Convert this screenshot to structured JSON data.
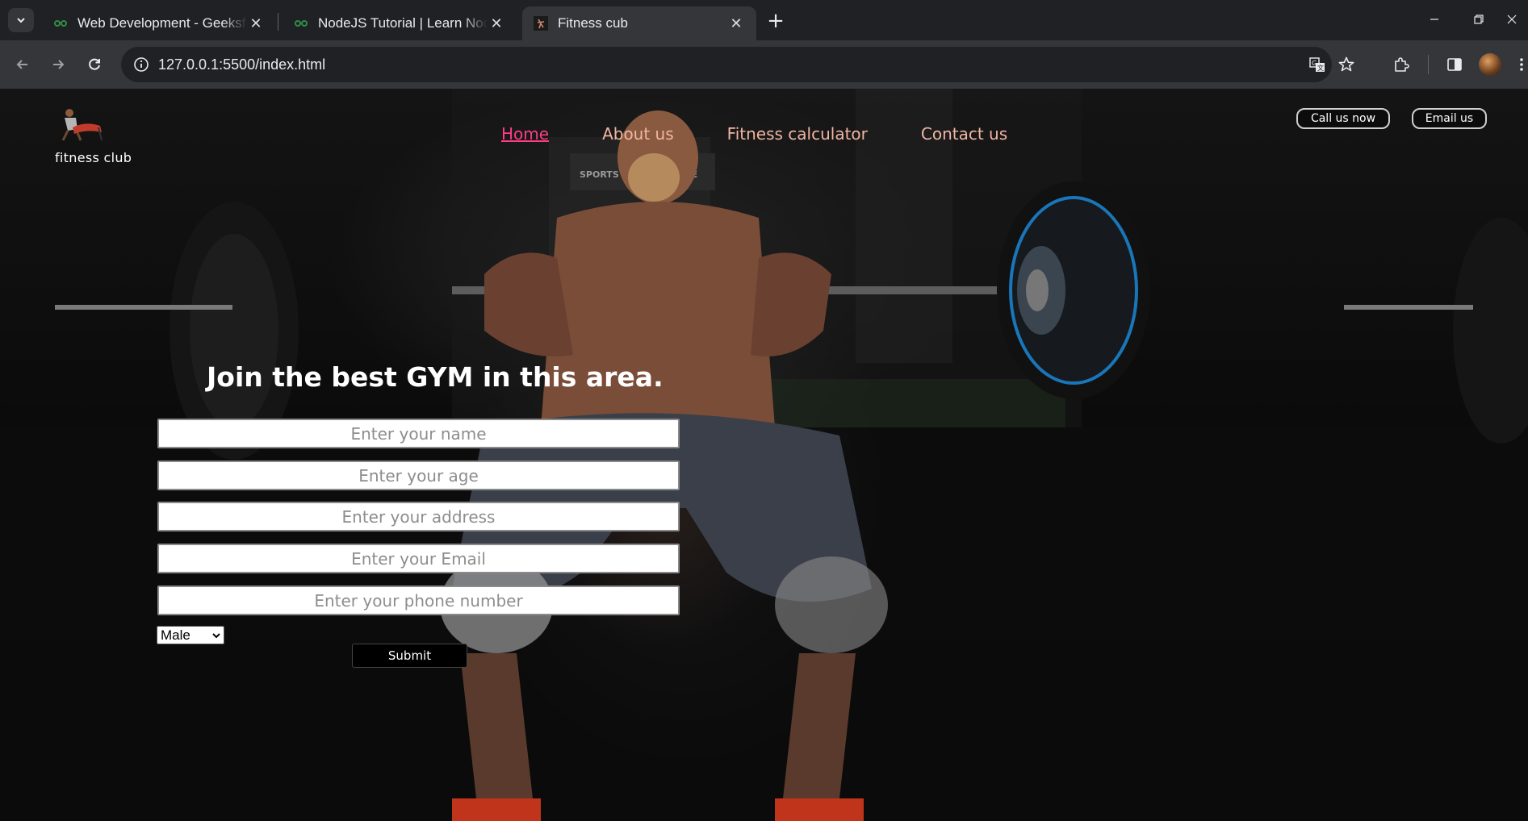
{
  "browser": {
    "tabs": [
      {
        "title": "Web Development - GeeksforGeeks",
        "favicon": "geeksforgeeks-icon",
        "active": false
      },
      {
        "title": "NodeJS Tutorial | Learn NodeJS",
        "favicon": "geeksforgeeks-icon",
        "active": false
      },
      {
        "title": "Fitness cub",
        "favicon": "fitness-site-icon",
        "active": true
      }
    ],
    "url": "127.0.0.1:5500/index.html",
    "accent_tab_bg": "#35363a",
    "frame_bg": "#202124"
  },
  "site": {
    "brand": "fitness club",
    "nav": [
      {
        "label": "Home",
        "active": true
      },
      {
        "label": "About us",
        "active": false
      },
      {
        "label": "Fitness calculator",
        "active": false
      },
      {
        "label": "Contact us",
        "active": false
      }
    ],
    "nav_color": "#f0b6a2",
    "nav_active_color": "#ff3d83",
    "actions": {
      "call_label": "Call us now",
      "email_label": "Email us"
    },
    "headline": "Join the best GYM in this area.",
    "form": {
      "name_placeholder": "Enter your name",
      "age_placeholder": "Enter your age",
      "address_placeholder": "Enter your address",
      "email_placeholder": "Enter your Email",
      "phone_placeholder": "Enter your phone number",
      "gender_value": "Male",
      "submit_label": "Submit"
    }
  }
}
